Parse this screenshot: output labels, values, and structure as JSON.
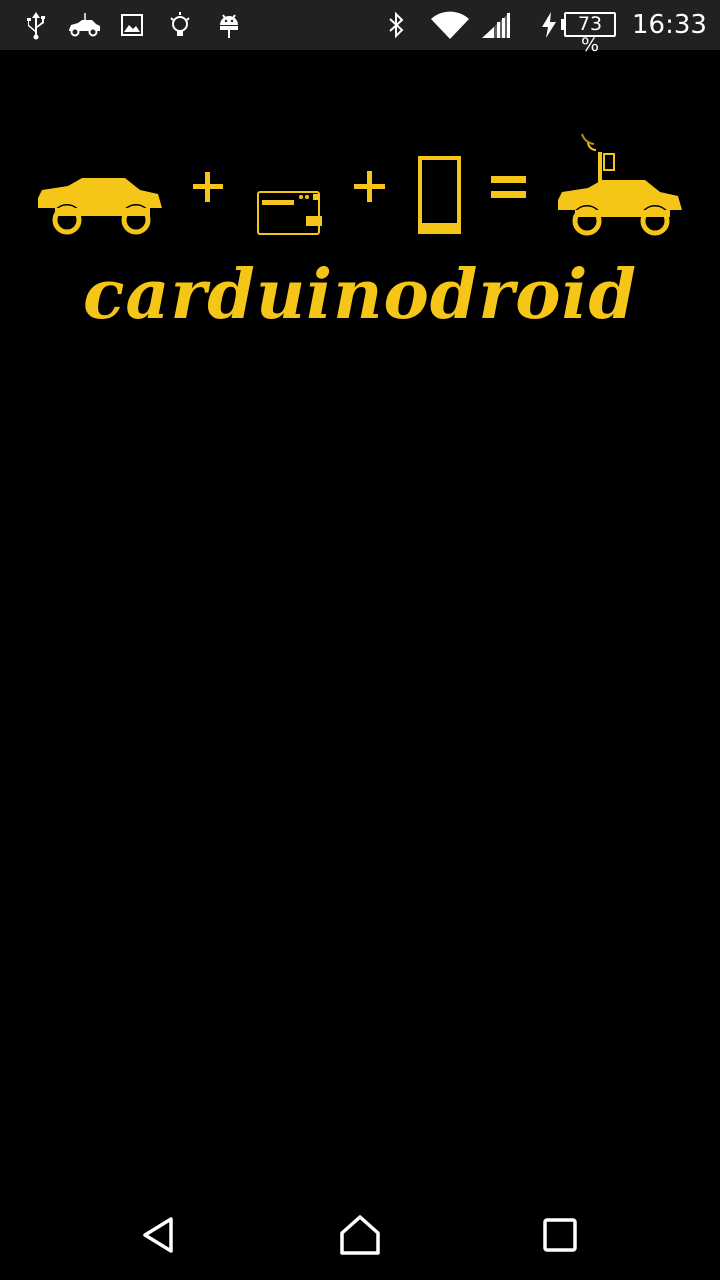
{
  "status_bar": {
    "left_icons": [
      "usb-icon",
      "car-notification-icon",
      "image-icon",
      "lightbulb-icon",
      "android-icon"
    ],
    "right_icons": [
      "bluetooth-icon",
      "wifi-icon",
      "cell-signal-icon",
      "charging-icon"
    ],
    "battery_percent": "73 %",
    "time": "16:33"
  },
  "app": {
    "brand_name": "carduinodroid",
    "equation_icons": [
      "rc-car-icon",
      "plus-icon",
      "arduino-board-icon",
      "plus-icon",
      "phone-icon",
      "equals-icon",
      "rc-car-with-phone-icon"
    ],
    "accent_color": "#F5C518",
    "background_color": "#000000"
  },
  "nav_bar": {
    "buttons": [
      "back-button",
      "home-button",
      "recents-button"
    ]
  }
}
